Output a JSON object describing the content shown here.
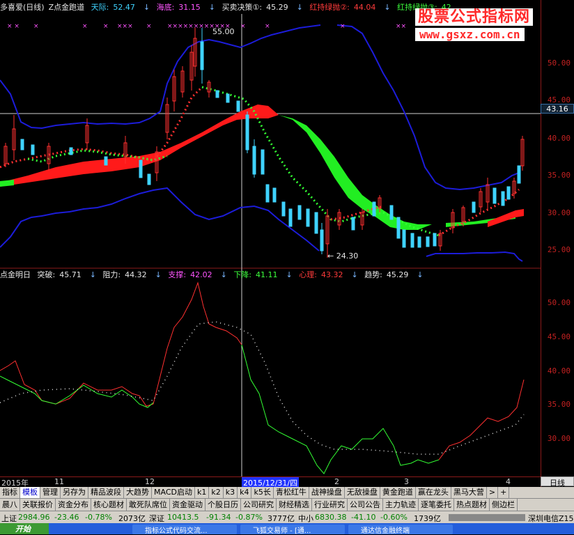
{
  "header": {
    "app_title": "多喜爱(日线)",
    "indicator": "Z点金跑道",
    "items": [
      {
        "label": "天际:",
        "value": "52.47",
        "color": "cyan"
      },
      {
        "label": "海底:",
        "value": "31.15",
        "color": "mag"
      },
      {
        "label": "买卖决策①:",
        "value": "45.29",
        "color": "white"
      },
      {
        "label": "红持绿抛②:",
        "value": "44.04",
        "color": "red"
      },
      {
        "label": "红持绿抛③:",
        "value": "42",
        "color": "green"
      }
    ]
  },
  "watermark": {
    "title": "股票公式指标网",
    "url": "www.gsxz.com.cn"
  },
  "main_axis": {
    "ticks": [
      "50.00",
      "45.00",
      "40.00",
      "35.00",
      "30.00",
      "25.00"
    ],
    "crosshair_price": "43.16"
  },
  "main_annotations": {
    "high": "55.00",
    "low": "24.30"
  },
  "sub_header": {
    "name": "点金明日",
    "items": [
      {
        "label": "突破:",
        "value": "45.71",
        "color": "white"
      },
      {
        "label": "阻力:",
        "value": "44.32",
        "color": "white"
      },
      {
        "label": "支撑:",
        "value": "42.02",
        "color": "mag"
      },
      {
        "label": "下降:",
        "value": "41.11",
        "color": "green"
      },
      {
        "label": "心理:",
        "value": "43.32",
        "color": "red"
      },
      {
        "label": "趋势:",
        "value": "45.29",
        "color": "white"
      }
    ]
  },
  "sub_axis": {
    "ticks": [
      "50.00",
      "45.00",
      "40.00",
      "35.00",
      "30.00"
    ]
  },
  "date_axis": {
    "labels": [
      "2015年",
      "11",
      "12",
      "2015/12/31/四",
      "2",
      "3",
      "4"
    ],
    "period": "日线"
  },
  "tabs_row1": [
    "指标",
    "模板",
    "管理",
    "另存为",
    "精品波段",
    "大趋势",
    "MACD启动",
    "k1",
    "k2",
    "k3",
    "k4",
    "k5长",
    "青松红牛",
    "战神操盘",
    "无敌操盘",
    "黄金跑道",
    "赢在龙头",
    "黑马大营"
  ],
  "tabs_row1_active": "模板",
  "tabs_row2": [
    "晨八",
    "关联报价",
    "资金分布",
    "核心题材",
    "敢死队席位",
    "资金驱动",
    "个股日历",
    "公司研究",
    "财经精选",
    "行业研究",
    "公司公告",
    "主力轨迹",
    "逐笔委托",
    "热点题材",
    "侧边栏"
  ],
  "status": {
    "sh": {
      "label": "上证",
      "value": "2984.96",
      "chg": "-23.46",
      "pct": "-0.78%",
      "vol": "2073亿"
    },
    "sz": {
      "label": "深证",
      "value": "10413.5",
      "chg": "-91.34",
      "pct": "-0.87%",
      "vol": "3777亿"
    },
    "zx": {
      "label": "中小",
      "value": "6830.38",
      "chg": "-41.10",
      "pct": "-0.60%",
      "vol": "1739亿"
    },
    "server": "深圳电信Z15"
  },
  "taskbar": {
    "start": "开始",
    "tasks": [
      "指标公式代码交流...",
      "飞狐交易师 - [通...",
      "通达信金融终端"
    ]
  }
}
